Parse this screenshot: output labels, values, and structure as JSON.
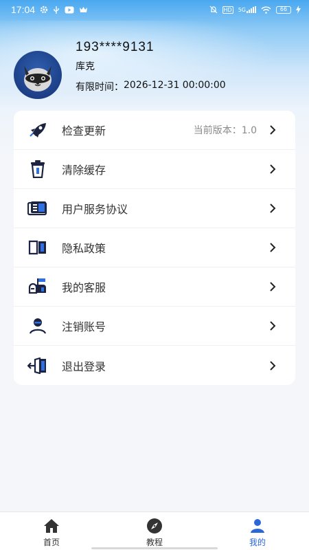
{
  "status_bar": {
    "time": "17:04",
    "left_icons": [
      "gear-icon",
      "usb-icon",
      "video-icon",
      "crown-icon"
    ],
    "right_icons": [
      "mute-icon",
      "hd-icon",
      "signal-5g-icon",
      "wifi-icon",
      "battery-icon",
      "charging-icon"
    ],
    "hd_text": "HD",
    "network_text": "5G",
    "battery_text": "66"
  },
  "profile": {
    "phone": "193****9131",
    "nickname": "库克",
    "expiry_label": "有限时间：",
    "expiry_value": "2026-12-31 00:00:00"
  },
  "menu": {
    "items": [
      {
        "label": "检查更新",
        "icon": "rocket-icon",
        "extra": "当前版本：1.0"
      },
      {
        "label": "清除缓存",
        "icon": "trash-icon"
      },
      {
        "label": "用户服务协议",
        "icon": "agreement-icon"
      },
      {
        "label": "隐私政策",
        "icon": "book-icon"
      },
      {
        "label": "我的客服",
        "icon": "mailbox-icon"
      },
      {
        "label": "注销账号",
        "icon": "user-cancel-icon"
      },
      {
        "label": "退出登录",
        "icon": "logout-icon"
      }
    ]
  },
  "bottom_nav": {
    "items": [
      {
        "label": "首页",
        "icon": "home-icon",
        "active": false
      },
      {
        "label": "教程",
        "icon": "compass-icon",
        "active": false
      },
      {
        "label": "我的",
        "icon": "person-icon",
        "active": true
      }
    ]
  },
  "colors": {
    "accent": "#2a67d8",
    "icon_dark": "#1c2340",
    "icon_blue": "#2f6fe0"
  }
}
